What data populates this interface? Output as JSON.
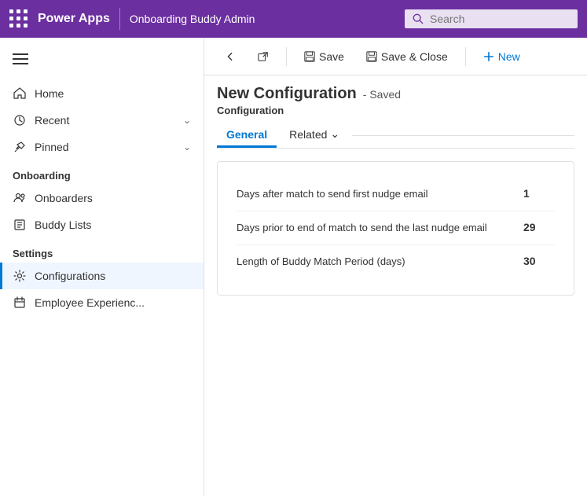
{
  "topbar": {
    "app_name": "Power Apps",
    "section_name": "Onboarding Buddy Admin",
    "search_placeholder": "Search"
  },
  "sidebar": {
    "hamburger_label": "Menu",
    "nav_items": [
      {
        "id": "home",
        "label": "Home",
        "icon": "home-icon",
        "expandable": false
      },
      {
        "id": "recent",
        "label": "Recent",
        "icon": "clock-icon",
        "expandable": true
      },
      {
        "id": "pinned",
        "label": "Pinned",
        "icon": "pin-icon",
        "expandable": true
      }
    ],
    "sections": [
      {
        "title": "Onboarding",
        "items": [
          {
            "id": "onboarders",
            "label": "Onboarders",
            "icon": "onboarders-icon"
          },
          {
            "id": "buddy-lists",
            "label": "Buddy Lists",
            "icon": "buddy-lists-icon"
          }
        ]
      },
      {
        "title": "Settings",
        "items": [
          {
            "id": "configurations",
            "label": "Configurations",
            "icon": "gear-icon",
            "active": true
          },
          {
            "id": "employee-experience",
            "label": "Employee Experienc...",
            "icon": "calendar-icon"
          }
        ]
      }
    ]
  },
  "toolbar": {
    "back_label": "",
    "external_label": "",
    "save_label": "Save",
    "save_close_label": "Save & Close",
    "new_label": "New"
  },
  "record": {
    "title": "New Configuration",
    "status": "- Saved",
    "entity": "Configuration"
  },
  "tabs": [
    {
      "id": "general",
      "label": "General",
      "active": true
    },
    {
      "id": "related",
      "label": "Related",
      "active": false
    }
  ],
  "form": {
    "fields": [
      {
        "label": "Days after match to send first nudge email",
        "value": "1"
      },
      {
        "label": "Days prior to end of match to send the last nudge email",
        "value": "29"
      },
      {
        "label": "Length of Buddy Match Period (days)",
        "value": "30"
      }
    ]
  }
}
